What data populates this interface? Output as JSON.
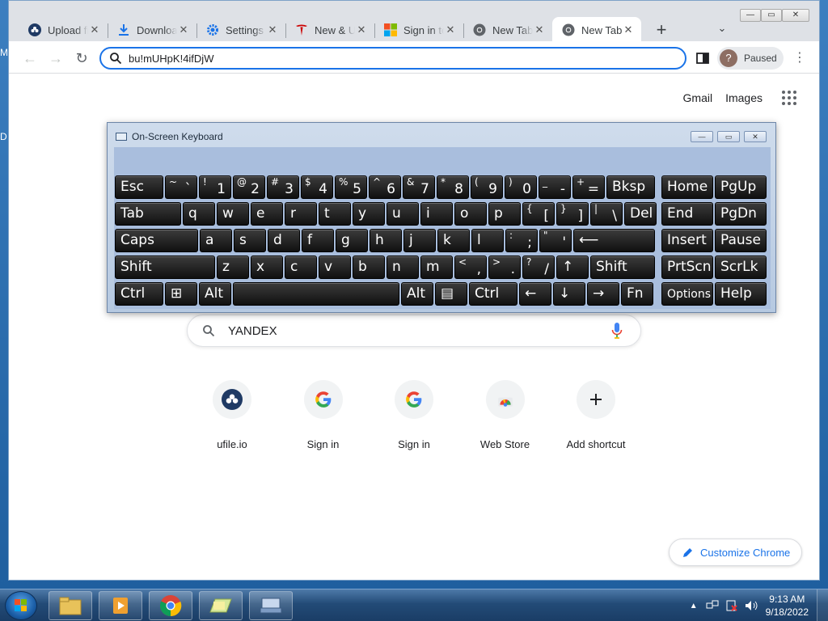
{
  "desktop": {
    "edge_text_1": "M",
    "edge_text_2": "D"
  },
  "tabs": [
    {
      "title": "Upload files",
      "icon": "ufile-icon",
      "close": "✕"
    },
    {
      "title": "Downloads",
      "icon": "download-icon",
      "close": "✕"
    },
    {
      "title": "Settings",
      "icon": "gear-icon",
      "close": "✕"
    },
    {
      "title": "New & Used",
      "icon": "tesla-icon",
      "close": "✕"
    },
    {
      "title": "Sign in to",
      "icon": "microsoft-icon",
      "close": "✕"
    },
    {
      "title": "New Tab",
      "icon": "chrome-icon",
      "close": "✕"
    },
    {
      "title": "New Tab",
      "icon": "chrome-icon",
      "close": "✕"
    }
  ],
  "tabstrip": {
    "new_tab": "+",
    "tab_search": "⌄"
  },
  "window_controls": {
    "minimize": "—",
    "maximize": "▭",
    "close": "✕"
  },
  "toolbar": {
    "back": "←",
    "forward": "→",
    "reload": "↻",
    "omnibox_value": "bu!mUHpK!4ifDjW",
    "profile_initial": "?",
    "profile_status": "Paused",
    "menu": "⋮"
  },
  "ntp": {
    "gmail": "Gmail",
    "images": "Images",
    "search_text": "YANDEX",
    "shortcuts": [
      {
        "label": "ufile.io",
        "icon": "ufile-icon"
      },
      {
        "label": "Sign in",
        "icon": "google-icon"
      },
      {
        "label": "Sign in",
        "icon": "google-icon"
      },
      {
        "label": "Web Store",
        "icon": "webstore-icon"
      },
      {
        "label": "Add shortcut",
        "icon": "plus-icon"
      }
    ],
    "customize": "Customize Chrome"
  },
  "osk": {
    "title": "On-Screen Keyboard",
    "controls": {
      "minimize": "—",
      "restore": "▭",
      "close": "✕"
    },
    "rows": [
      [
        {
          "l": "Esc"
        },
        {
          "sup": "~",
          "sub": "`"
        },
        {
          "sup": "!",
          "sub": "1"
        },
        {
          "sup": "@",
          "sub": "2"
        },
        {
          "sup": "#",
          "sub": "3"
        },
        {
          "sup": "$",
          "sub": "4"
        },
        {
          "sup": "%",
          "sub": "5"
        },
        {
          "sup": "^",
          "sub": "6"
        },
        {
          "sup": "&",
          "sub": "7"
        },
        {
          "sup": "*",
          "sub": "8"
        },
        {
          "sup": "(",
          "sub": "9"
        },
        {
          "sup": ")",
          "sub": "0"
        },
        {
          "sup": "_",
          "sub": "-"
        },
        {
          "sup": "+",
          "sub": "="
        },
        {
          "l": "Bksp"
        },
        {
          "l": "Home"
        },
        {
          "l": "PgUp"
        }
      ],
      [
        {
          "l": "Tab"
        },
        {
          "l": "q"
        },
        {
          "l": "w"
        },
        {
          "l": "e"
        },
        {
          "l": "r"
        },
        {
          "l": "t"
        },
        {
          "l": "y"
        },
        {
          "l": "u"
        },
        {
          "l": "i"
        },
        {
          "l": "o"
        },
        {
          "l": "p"
        },
        {
          "sup": "{",
          "sub": "["
        },
        {
          "sup": "}",
          "sub": "]"
        },
        {
          "sup": "|",
          "sub": "\\"
        },
        {
          "l": "Del"
        },
        {
          "l": "End"
        },
        {
          "l": "PgDn"
        }
      ],
      [
        {
          "l": "Caps"
        },
        {
          "l": "a"
        },
        {
          "l": "s"
        },
        {
          "l": "d"
        },
        {
          "l": "f"
        },
        {
          "l": "g"
        },
        {
          "l": "h"
        },
        {
          "l": "j"
        },
        {
          "l": "k"
        },
        {
          "l": "l"
        },
        {
          "sup": ":",
          "sub": ";"
        },
        {
          "sup": "\"",
          "sub": "'"
        },
        {
          "l": "⟵"
        },
        {
          "l": "Insert"
        },
        {
          "l": "Pause"
        }
      ],
      [
        {
          "l": "Shift"
        },
        {
          "l": "z"
        },
        {
          "l": "x"
        },
        {
          "l": "c"
        },
        {
          "l": "v"
        },
        {
          "l": "b"
        },
        {
          "l": "n"
        },
        {
          "l": "m"
        },
        {
          "sup": "<",
          "sub": ","
        },
        {
          "sup": ">",
          "sub": "."
        },
        {
          "sup": "?",
          "sub": "/"
        },
        {
          "l": "↑"
        },
        {
          "l": "Shift"
        },
        {
          "l": "PrtScn"
        },
        {
          "l": "ScrLk"
        }
      ],
      [
        {
          "l": "Ctrl"
        },
        {
          "l": "⊞"
        },
        {
          "l": "Alt"
        },
        {
          "l": ""
        },
        {
          "l": "Alt"
        },
        {
          "l": "▤"
        },
        {
          "l": "Ctrl"
        },
        {
          "l": "←"
        },
        {
          "l": "↓"
        },
        {
          "l": "→"
        },
        {
          "l": "Fn"
        },
        {
          "l": "Options",
          "small": true
        },
        {
          "l": "Help"
        }
      ]
    ]
  },
  "taskbar": {
    "time": "9:13 AM",
    "date": "9/18/2022",
    "items": [
      "explorer-icon",
      "media-player-icon",
      "chrome-icon",
      "folder-icon",
      "keyboard-icon"
    ]
  }
}
